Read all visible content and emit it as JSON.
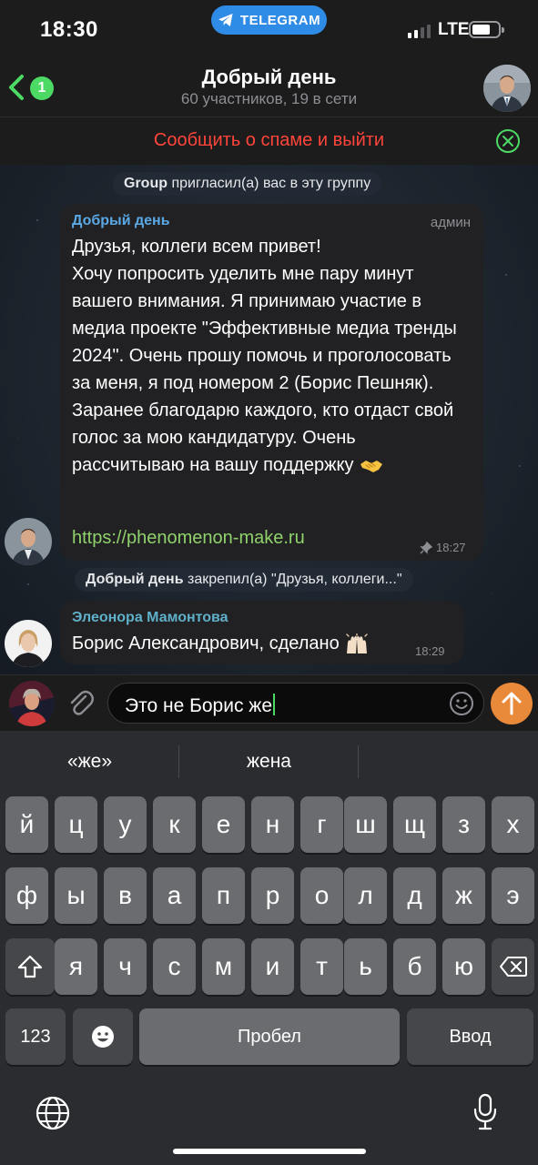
{
  "status_bar": {
    "time": "18:30",
    "app_pill": "TELEGRAM",
    "network": "LTE"
  },
  "header": {
    "unread_count": "1",
    "title": "Добрый день",
    "subtitle": "60 участников, 19 в сети"
  },
  "spam_banner": {
    "text": "Сообщить о спаме и выйти"
  },
  "messages": {
    "service_1": {
      "actor": "Group",
      "text": "пригласил(а) вас в эту группу"
    },
    "msg_1": {
      "sender": "Добрый день",
      "role": "админ",
      "text": "Друзья, коллеги всем привет!\nХочу попросить уделить мне пару минут вашего внимания. Я принимаю участие в медиа проекте \"Эффективные медиа тренды 2024\". Очень прошу помочь и проголосовать за меня, я под номером 2 (Борис Пешняк). Заранее благодарю каждого, кто отдаст свой голос за мою кандидатуру. Очень рассчитываю на вашу поддержку",
      "emoji": "handshake",
      "link": "https://phenomenon-make.ru",
      "time": "18:27"
    },
    "service_2": {
      "actor": "Добрый день",
      "text": "закрепил(а) \"Друзья, коллеги...\""
    },
    "msg_2": {
      "sender": "Элеонора Мамонтова",
      "text": "Борис Александрович, сделано",
      "emoji": "raised-hands",
      "time": "18:29"
    }
  },
  "composer": {
    "value": "Это не Борис же"
  },
  "keyboard": {
    "suggestions": [
      "«же»",
      "жена",
      ""
    ],
    "row1": [
      "й",
      "ц",
      "у",
      "к",
      "е",
      "н",
      "г",
      "ш",
      "щ",
      "з",
      "х"
    ],
    "row2": [
      "ф",
      "ы",
      "в",
      "а",
      "п",
      "р",
      "о",
      "л",
      "д",
      "ж",
      "э"
    ],
    "row3": [
      "я",
      "ч",
      "с",
      "м",
      "и",
      "т",
      "ь",
      "б",
      "ю"
    ],
    "numbers_key": "123",
    "space_key": "Пробел",
    "return_key": "Ввод"
  },
  "colors": {
    "accent_blue": "#2f8ce6",
    "spam_red": "#ff453a",
    "admin_name": "#5aa9e6",
    "member_name": "#5fb0c9",
    "link_green": "#8fd26b",
    "send_orange": "#e9893a",
    "unread_green": "#4cd964"
  }
}
